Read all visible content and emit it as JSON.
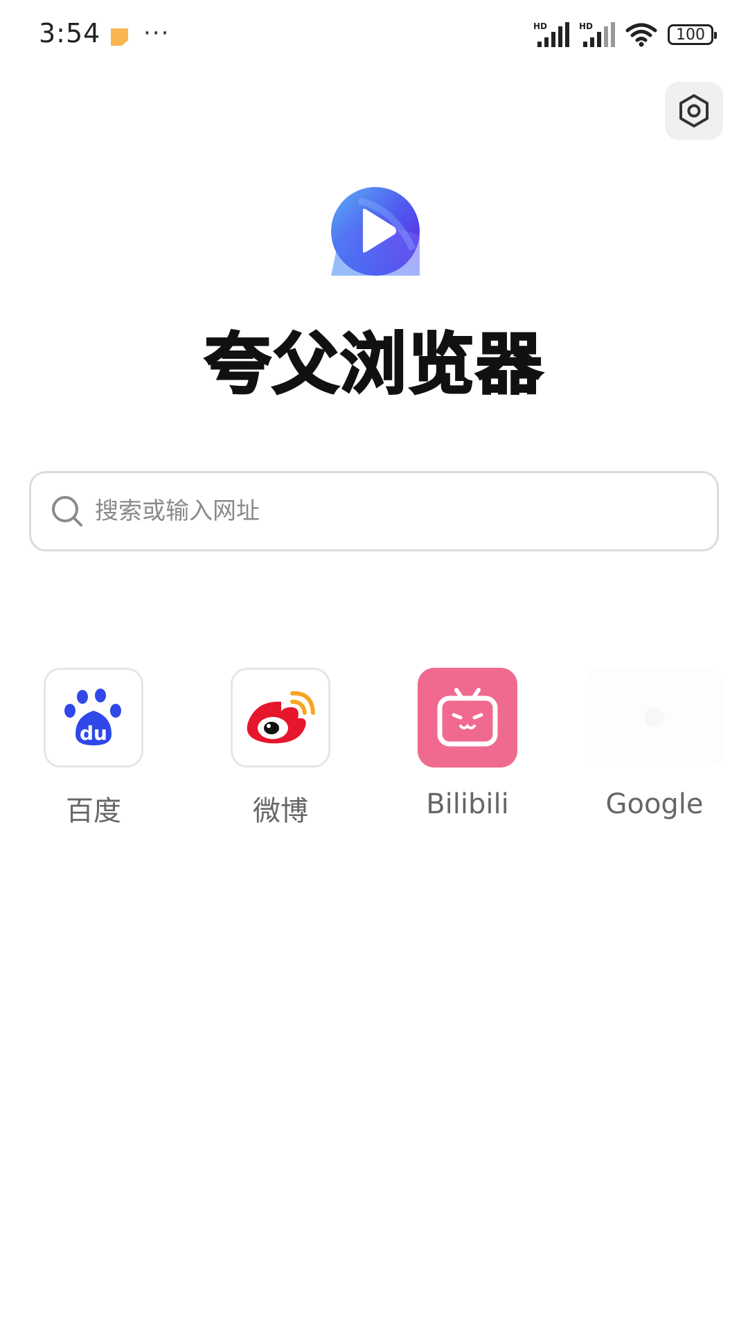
{
  "status_bar": {
    "time": "3:54",
    "more": "···",
    "battery": "100",
    "icons": [
      "notification-icon",
      "signal-hd-icon",
      "signal-hd-icon",
      "wifi-icon",
      "battery-icon"
    ]
  },
  "settings": {
    "icon": "settings-icon"
  },
  "app": {
    "title": "夸父浏览器",
    "logo_icon": "play-logo-icon"
  },
  "search": {
    "placeholder": "搜索或输入网址",
    "value": "",
    "icon": "search-icon"
  },
  "shortcuts": [
    {
      "label": "百度",
      "icon": "baidu-icon"
    },
    {
      "label": "微博",
      "icon": "weibo-icon"
    },
    {
      "label": "Bilibili",
      "icon": "bilibili-icon",
      "color": "#f06a8f"
    },
    {
      "label": "Google",
      "icon": "google-icon"
    }
  ],
  "colors": {
    "accent": "#5b3df5",
    "baidu": "#3048e8",
    "weibo": "#e6162d",
    "bilibili": "#f06a8f"
  }
}
